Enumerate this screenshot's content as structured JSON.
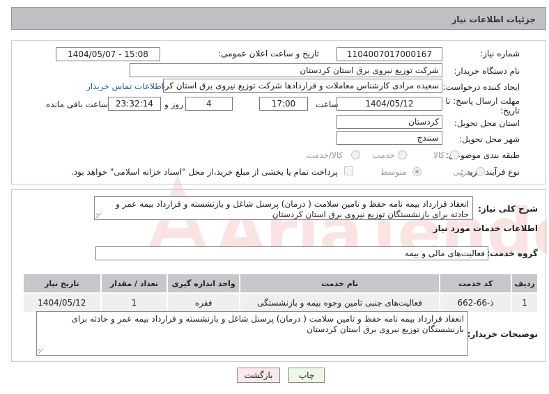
{
  "header": {
    "title": "جزئیات اطلاعات نیاز"
  },
  "form": {
    "need_number": {
      "label": "شماره نیاز:",
      "value": "1104007017000167"
    },
    "announce_datetime": {
      "label": "تاریخ و ساعت اعلان عمومی:",
      "value": "1404/05/07 - 15:08"
    },
    "buyer_org": {
      "label": "نام دستگاه خریدار:",
      "value": "شرکت توزیع نیروی برق استان کردستان"
    },
    "requester": {
      "label": "ایجاد کننده درخواست:",
      "value": "سعیده مرادی کارشناس معاملات و قراردادها شرکت توزیع نیروی برق استان کرد",
      "contact_link": "اطلاعات تماس خریدار"
    },
    "deadline": {
      "label_line1": "مهلت ارسال پاسخ: تا",
      "label_line2": "تاریخ:",
      "date": "1404/05/12",
      "time_label": "ساعت",
      "time": "17:00",
      "days": "4",
      "days_label": "روز و",
      "remaining": "23:32:14",
      "remaining_label": "ساعت باقی مانده"
    },
    "province": {
      "label": "استان محل تحویل:",
      "value": "کردستان"
    },
    "city": {
      "label": "شهر محل تحویل:",
      "value": "سنندج"
    },
    "category": {
      "label": "طبقه بندی موضوعی:",
      "options": [
        "کالا",
        "خدمت",
        "کالا/خدمت"
      ]
    },
    "purchase_type": {
      "label": "نوع فرآیند خرید :",
      "options": [
        "جزیی",
        "متوسط"
      ],
      "checkbox_text": "پرداخت تمام یا بخشی از مبلغ خرید،از محل \"اسناد خزانه اسلامی\" خواهد بود."
    }
  },
  "summary": {
    "label": "شرح کلی نیاز:",
    "text": "انعقاد قرارداد بیمه نامه حفظ و تامین سلامت ( درمان) پرسنل شاغل و بازنشسته و قرارداد بیمه عمر و حادثه برای بازنشستگان توزیع نیروی برق استان کردستان"
  },
  "services": {
    "title": "اطلاعات خدمات مورد نیاز",
    "group_label": "گروه خدمت:",
    "group_value": "فعالیت‌های مالی و بیمه",
    "columns": [
      "ردیف",
      "کد خدمت",
      "نام خدمت",
      "واحد اندازه گیری",
      "تعداد / مقدار",
      "تاریخ نیاز"
    ],
    "rows": [
      [
        "1",
        "ذ-66-662",
        "فعالیت‌های جنبی تامین وجوه بیمه و بازنشستگی",
        "فقره",
        "1",
        "1404/05/12"
      ]
    ]
  },
  "buyer_notes": {
    "label": "توضیحات خریدار:",
    "text": "انعقاد قرارداد بیمه نامه حفظ و تامین سلامت ( درمان) پرسنل شاغل و بازنشسته و قرارداد بیمه عمر و حادثه برای بازنشستگان توزیع نیروی برق استان کردستان"
  },
  "buttons": {
    "print": "چاپ",
    "back": "بازگشت"
  },
  "watermark": {
    "text": "AriaTender.neT"
  },
  "colors": {
    "header_bg": "#c0c0c4",
    "link": "#1e5ab4",
    "print_btn_bg": "#eef8e8",
    "back_btn_bg": "#fbe8ea",
    "watermark": "#d23a2a"
  }
}
